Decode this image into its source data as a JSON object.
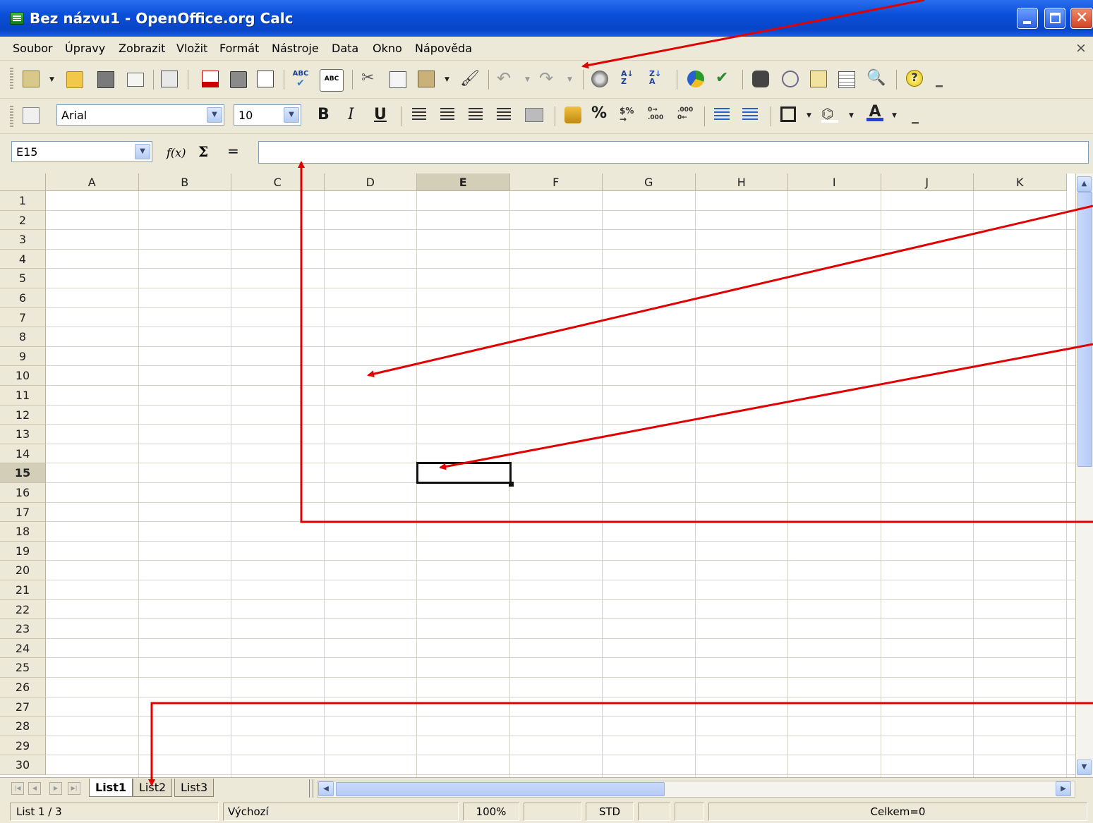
{
  "window": {
    "title": "Bez názvu1 - OpenOffice.org Calc"
  },
  "menu": [
    "Soubor",
    "Úpravy",
    "Zobrazit",
    "Vložit",
    "Formát",
    "Nástroje",
    "Data",
    "Okno",
    "Nápověda"
  ],
  "doc_close": "×",
  "toolbar2": {
    "font_name": "Arial",
    "font_size": "10",
    "bold": "B",
    "italic": "I",
    "underline": "U",
    "percent": "%"
  },
  "formula_bar": {
    "cell_ref": "E15",
    "fx_label": "f(x)",
    "sum_label": "Σ",
    "equals_label": "=",
    "value": ""
  },
  "grid": {
    "columns": [
      "A",
      "B",
      "C",
      "D",
      "E",
      "F",
      "G",
      "H",
      "I",
      "J",
      "K"
    ],
    "rows": [
      "1",
      "2",
      "3",
      "4",
      "5",
      "6",
      "7",
      "8",
      "9",
      "10",
      "11",
      "12",
      "13",
      "14",
      "15",
      "16",
      "17",
      "18",
      "19",
      "20",
      "21",
      "22",
      "23",
      "24",
      "25",
      "26",
      "27",
      "28",
      "29",
      "30"
    ],
    "selected_column": "E",
    "selected_row": "15"
  },
  "sheets": [
    "List1",
    "List2",
    "List3"
  ],
  "active_sheet": "List1",
  "status": {
    "sheet_pos": "List 1 / 3",
    "style": "Výchozí",
    "zoom": "100%",
    "mode": "STD",
    "sum": "Celkem=0"
  },
  "colors": {
    "title_bar": "#0a4fd8",
    "chrome": "#ece9d8",
    "annotation": "#e00000"
  }
}
